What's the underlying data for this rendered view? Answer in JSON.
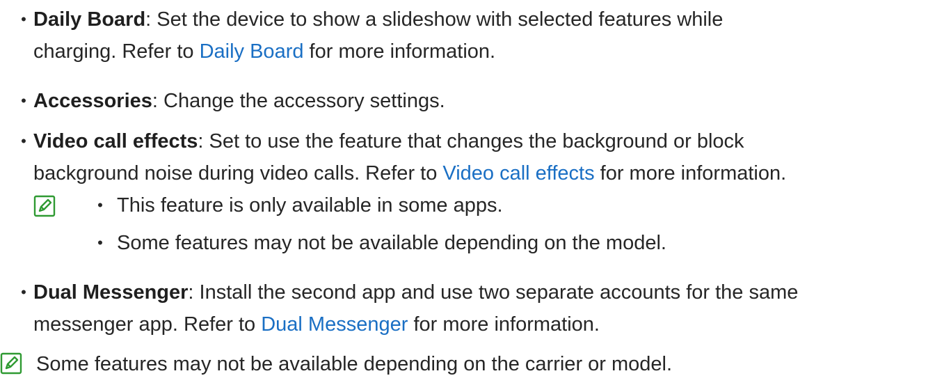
{
  "items": [
    {
      "term": "Daily Board",
      "line1_rest": ": Set the device to show a slideshow with selected features while",
      "line2_prefix": "charging. Refer to ",
      "link": "Daily Board",
      "line2_suffix": " for more information."
    },
    {
      "term": "Accessories",
      "line1_rest": ": Change the accessory settings."
    },
    {
      "term": "Video call effects",
      "line1_rest": ": Set to use the feature that changes the background or block",
      "line2_prefix": "background noise during video calls. Refer to ",
      "link": "Video call effects",
      "line2_suffix": " for more information."
    },
    {
      "term": "Dual Messenger",
      "line1_rest": ": Install the second app and use two separate accounts for the same",
      "line2_prefix": "messenger app. Refer to ",
      "link": "Dual Messenger",
      "line2_suffix": " for more information."
    }
  ],
  "video_note": {
    "icon": "note-icon",
    "points": [
      "This feature is only available in some apps.",
      "Some features may not be available depending on the model."
    ]
  },
  "final_note": {
    "icon": "note-icon",
    "text": "Some features may not be available depending on the carrier or model."
  },
  "colors": {
    "text": "#262626",
    "link": "#1a6fc4",
    "icon": "#2f9a32"
  },
  "bullet_glyph": "•"
}
